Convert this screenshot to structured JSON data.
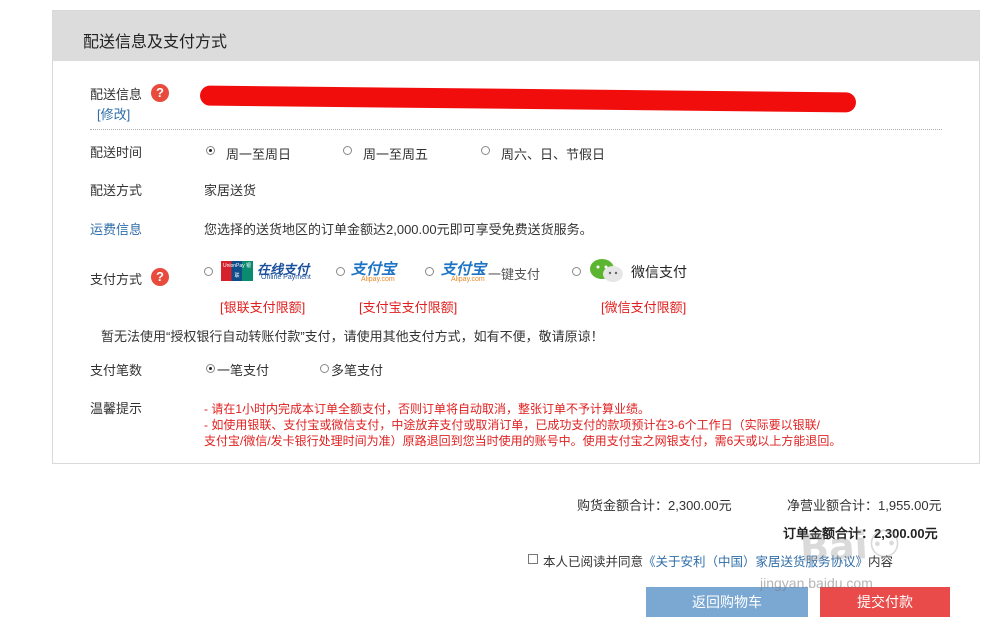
{
  "section": {
    "title": "配送信息及支付方式"
  },
  "delivery_info": {
    "label": "配送信息",
    "help": "?",
    "edit_link": "[修改]"
  },
  "delivery_time": {
    "label": "配送时间",
    "options": [
      "周一至周日",
      "周一至周五",
      "周六、日、节假日"
    ],
    "selected_index": 0
  },
  "delivery_method": {
    "label": "配送方式",
    "value": "家居送货"
  },
  "shipping_fee": {
    "label": "运费信息",
    "text": "您选择的送货地区的订单金额达2,000.00元即可享受免费送货服务。"
  },
  "payment_method": {
    "label": "支付方式",
    "help": "?",
    "options": [
      {
        "logo_text": "在线支付",
        "logo_sub": "Online Payment",
        "badge": "UnionPay 银联",
        "limit_link": "[银联支付限额]"
      },
      {
        "logo_text": "支付宝",
        "logo_sub": "Alipay.com",
        "limit_link": "[支付宝支付限额]"
      },
      {
        "logo_text": "支付宝",
        "logo_sub": "Alipay.com",
        "extra": "一键支付"
      },
      {
        "logo_text": "微信支付",
        "icon": "wechat-icon",
        "limit_link": "[微信支付限额]"
      }
    ],
    "notice": "暂无法使用“授权银行自动转账付款”支付，请使用其他支付方式，如有不便，敬请原谅！"
  },
  "payment_count": {
    "label": "支付笔数",
    "options": [
      "一笔支付",
      "多笔支付"
    ],
    "selected_index": 0
  },
  "tips": {
    "label": "温馨提示",
    "line1": "- 请在1小时内完成本订单全额支付，否则订单将自动取消，整张订单不予计算业绩。",
    "line2": "- 如使用银联、支付宝或微信支付，中途放弃支付或取消订单，已成功支付的款项预计在3-6个工作日（实际要以银联/",
    "line3": "支付宝/微信/发卡银行处理时间为准）原路退回到您当时使用的账号中。使用支付宝之网银支付，需6天或以上方能退回。"
  },
  "summary": {
    "goods_total": "购货金额合计：2,300.00元",
    "net_sales": "净营业额合计：1,955.00元",
    "order_total_label": "订单金额合计：",
    "order_total_value": "2,300.00元"
  },
  "agreement": {
    "text": "本人已阅读并同意",
    "link": "《关于安利（中国）家居送货服务协议》",
    "tail": "内容"
  },
  "buttons": {
    "back": "返回购物车",
    "submit": "提交付款"
  },
  "watermark": "jingyan.baidu.com",
  "colors": {
    "header_bg": "#dcdcdc",
    "accent_red": "#e02020",
    "link_blue": "#2f6da8",
    "back_button": "#7ba8d3",
    "submit_button": "#e94b4b"
  }
}
